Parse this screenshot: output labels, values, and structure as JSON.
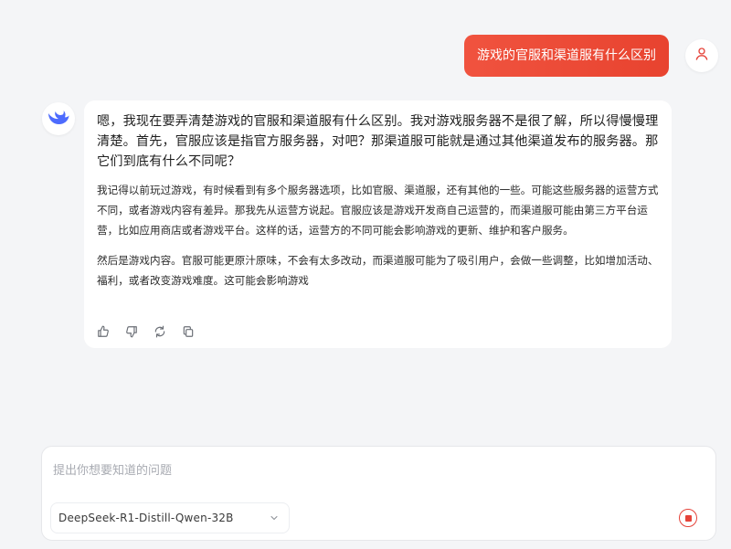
{
  "conversation": {
    "user_message": "游戏的官服和渠道服有什么区别",
    "assistant": {
      "think_text": "嗯，我现在要弄清楚游戏的官服和渠道服有什么区别。我对游戏服务器不是很了解，所以得慢慢理清楚。首先，官服应该是指官方服务器，对吧？那渠道服可能就是通过其他渠道发布的服务器。那它们到底有什么不同呢？",
      "paragraphs": [
        "我记得以前玩过游戏，有时候看到有多个服务器选项，比如官服、渠道服，还有其他的一些。可能这些服务器的运营方式不同，或者游戏内容有差异。那我先从运营方说起。官服应该是游戏开发商自己运营的，而渠道服可能由第三方平台运营，比如应用商店或者游戏平台。这样的话，运营方的不同可能会影响游戏的更新、维护和客户服务。",
        "然后是游戏内容。官服可能更原汁原味，不会有太多改动，而渠道服可能为了吸引用户，会做一些调整，比如增加活动、福利，或者改变游戏难度。这可能会影响游戏"
      ],
      "actions": [
        "thumbs-up-icon",
        "thumbs-down-icon",
        "regenerate-icon",
        "copy-icon"
      ]
    }
  },
  "composer": {
    "placeholder": "提出你想要知道的问题",
    "model": "DeepSeek-R1-Distill-Qwen-32B"
  },
  "colors": {
    "accent": "#e8432f",
    "background": "#f4f5f7",
    "card": "#ffffff",
    "logo": "#4d6bfe"
  }
}
